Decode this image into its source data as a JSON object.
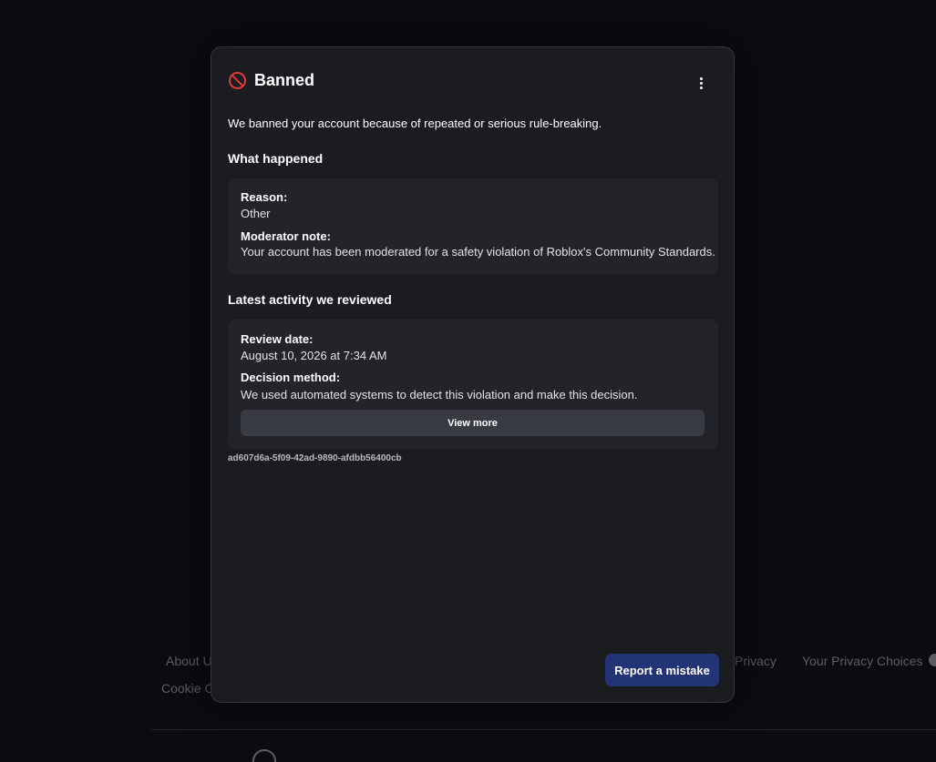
{
  "modal": {
    "title": "Banned",
    "icon": "ban-icon",
    "summary": "We banned your account because of repeated or serious rule-breaking.",
    "what_happened": {
      "heading": "What happened",
      "reason_label": "Reason:",
      "reason_value": "Other",
      "note_label": "Moderator note:",
      "note_value": "Your account has been moderated for a safety violation of Roblox's Community Standards."
    },
    "latest_activity": {
      "heading": "Latest activity we reviewed",
      "review_date_label": "Review date:",
      "review_date_value": "August 10, 2026 at 7:34 AM",
      "decision_label": "Decision method:",
      "decision_value": "We used automated systems to detect this violation and make this decision.",
      "view_more_label": "View more"
    },
    "incident_id": "ad607d6a-5f09-42ad-9890-afdbb56400cb",
    "report_label": "Report a mistake"
  },
  "footer": {
    "about": "About U",
    "privacy": "Privacy",
    "privacy_choices": "Your Privacy Choices",
    "cookie": "Cookie O"
  },
  "colors": {
    "accent": "#223475",
    "danger": "#e0393e",
    "modal_bg": "#1b1c20",
    "card_bg": "#232429"
  }
}
